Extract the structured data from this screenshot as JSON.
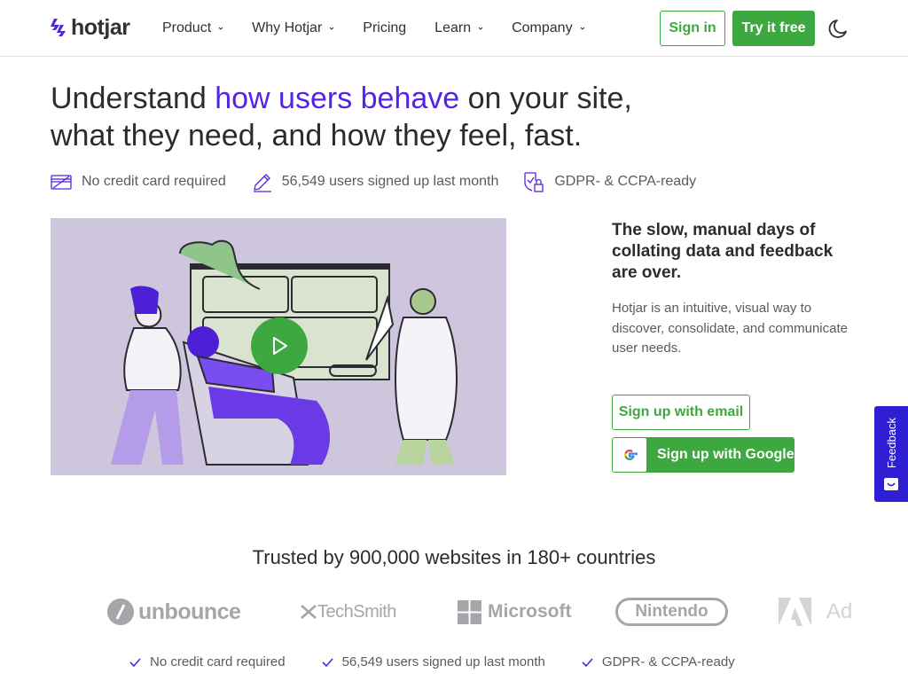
{
  "brand": {
    "name": "hotjar",
    "accent": "#5423e7",
    "green": "#3ea840"
  },
  "nav": {
    "items": [
      {
        "label": "Product",
        "has_dropdown": true
      },
      {
        "label": "Why Hotjar",
        "has_dropdown": true
      },
      {
        "label": "Pricing",
        "has_dropdown": false
      },
      {
        "label": "Learn",
        "has_dropdown": true
      },
      {
        "label": "Company",
        "has_dropdown": true
      }
    ],
    "sign_in": "Sign in",
    "try_free": "Try it free",
    "theme_icon": "moon-icon"
  },
  "hero": {
    "title_part1": "Understand ",
    "title_accent": "how users behave",
    "title_part2": " on your site, what they need, and how they feel, fast.",
    "badges": [
      {
        "icon": "credit-card-icon",
        "text": "No credit card required"
      },
      {
        "icon": "pencil-icon",
        "text": "56,549 users signed up last month"
      },
      {
        "icon": "shield-lock-icon",
        "text": "GDPR- & CCPA-ready"
      }
    ]
  },
  "side": {
    "title": "The slow, manual days of collating data and feedback are over.",
    "text": "Hotjar is an intuitive, visual way to discover, consolidate, and communicate user needs.",
    "signup_email": "Sign up with email",
    "signup_google": "Sign up with Google"
  },
  "feedback": {
    "label": "Feedback"
  },
  "trusted": {
    "title": "Trusted by 900,000 websites in 180+ countries",
    "logos": [
      "unbounce",
      "TechSmith",
      "Microsoft",
      "Nintendo",
      "Ad"
    ],
    "checks": [
      "No credit card required",
      "56,549 users signed up last month",
      "GDPR- & CCPA-ready"
    ]
  }
}
